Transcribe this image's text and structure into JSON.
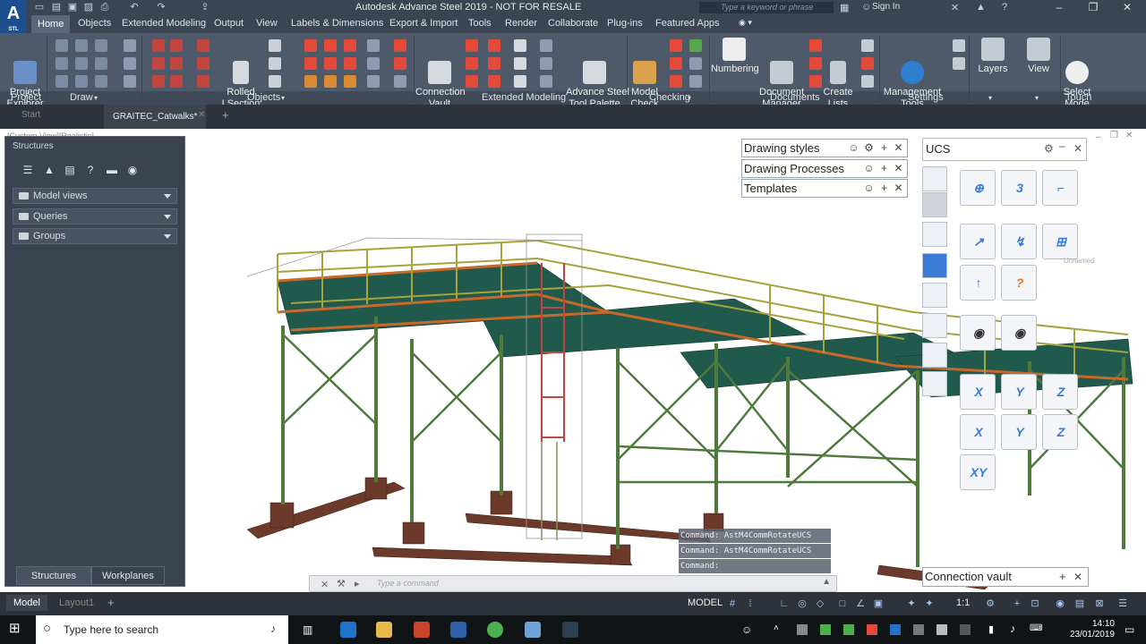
{
  "window": {
    "title": "Autodesk Advance Steel 2019 - NOT FOR RESALE",
    "search_placeholder": "Type a keyword or phrase",
    "sign_in": "Sign In",
    "logo": "A",
    "logo_sub": "STL"
  },
  "ribbon_tabs": [
    "Home",
    "Objects",
    "Extended Modeling",
    "Output",
    "View",
    "Labels & Dimensions",
    "Export & Import",
    "Tools",
    "Render",
    "Collaborate",
    "Plug-ins",
    "Featured Apps"
  ],
  "ribbon": {
    "project_explorer": "Project\nExplorer",
    "rolled_section": "Rolled\nI Section",
    "connection_vault": "Connection\nVault",
    "advance_steel_tool_palette": "Advance Steel\nTool Palette",
    "model_check": "Model\nCheck",
    "numbering": "Numbering",
    "document_manager": "Document\nManager",
    "create_lists": "Create\nLists",
    "management_tools": "Management\nTools",
    "layers": "Layers",
    "view": "View",
    "select_mode": "Select\nMode",
    "panels": {
      "project": "Project",
      "draw": "Draw",
      "objects": "Objects",
      "extended_modeling": "Extended Modeling",
      "checking": "Checking",
      "documents": "Documents",
      "settings": "Settings",
      "touch": "Touch"
    }
  },
  "doc_tabs": {
    "start": "Start",
    "active": "GRAITEC_Catwalks*"
  },
  "viewport": {
    "label": "[Custom View][Realistic]"
  },
  "structures_palette": {
    "title": "Structures",
    "rows": [
      "Model views",
      "Queries",
      "Groups"
    ],
    "tabs": [
      "Structures",
      "Workplanes"
    ]
  },
  "drawing_palette": {
    "rows": [
      "Drawing styles",
      "Drawing Processes",
      "Templates"
    ]
  },
  "ucs_palette": {
    "title": "UCS",
    "axis_buttons": [
      "X",
      "Y",
      "Z",
      "XY"
    ],
    "unnamed": "Unnamed"
  },
  "command": {
    "history": [
      "Command: AstM4CommRotateUCS",
      "Command: AstM4CommRotateUCS",
      "Command:"
    ],
    "placeholder": "Type a command"
  },
  "connection_vault_panel": "Connection vault",
  "status": {
    "tabs": [
      "Model",
      "Layout1"
    ],
    "model_label": "MODEL",
    "scale": "1:1"
  },
  "taskbar": {
    "search_placeholder": "Type here to search",
    "time": "14:10",
    "date": "23/01/2019"
  },
  "colors": {
    "railing": "#a5a33a",
    "deck": "#1f5a4c",
    "frame": "#4f7a3c",
    "footing": "#6b3a2a",
    "accent": "#3a7bd5"
  }
}
